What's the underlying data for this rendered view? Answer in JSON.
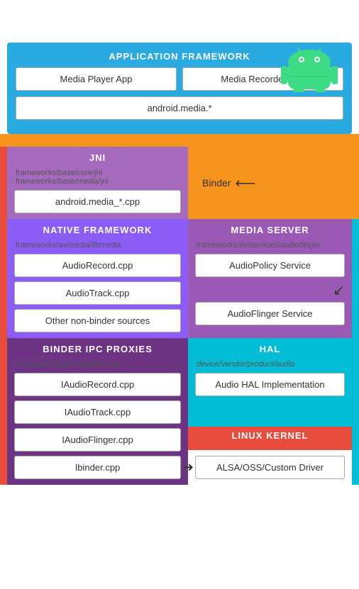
{
  "android": {
    "logo_color": "#3DDC84"
  },
  "app_framework": {
    "title": "APPLICATION FRAMEWORK",
    "media_player": "Media Player App",
    "media_recorder": "Media Recorder App",
    "android_media": "android.media.*"
  },
  "jni": {
    "title": "JNI",
    "line1": "frameworks/base/core/jni",
    "line2": "frameworks/base/media/jni",
    "cpp": "android.media_*.cpp"
  },
  "binder": {
    "label": "Binder"
  },
  "native_framework": {
    "title": "NATIVE FRAMEWORK",
    "path": "frameworks/av/media/libmedia",
    "items": [
      "AudioRecord.cpp",
      "AudioTrack.cpp",
      "Other non-binder sources"
    ]
  },
  "media_server": {
    "title": "MEDIA SERVER",
    "path": "frameworks/av/services/audioflinger",
    "items": [
      "AudioPolicy Service",
      "AudioFlinger Service"
    ]
  },
  "binder_ipc": {
    "title": "BINDER IPC PROXIES",
    "path": "frameworks/av/media/libmedia",
    "items": [
      "IAudioRecord.cpp",
      "IAudioTrack.cpp",
      "IAudioFlinger.cpp",
      "Ibinder.cpp"
    ]
  },
  "hal": {
    "title": "HAL",
    "path": "device/vendor/product/audio",
    "item": "Audio HAL Implementation"
  },
  "linux_kernel": {
    "title": "LINUX KERNEL",
    "item": "ALSA/OSS/Custom Driver"
  }
}
